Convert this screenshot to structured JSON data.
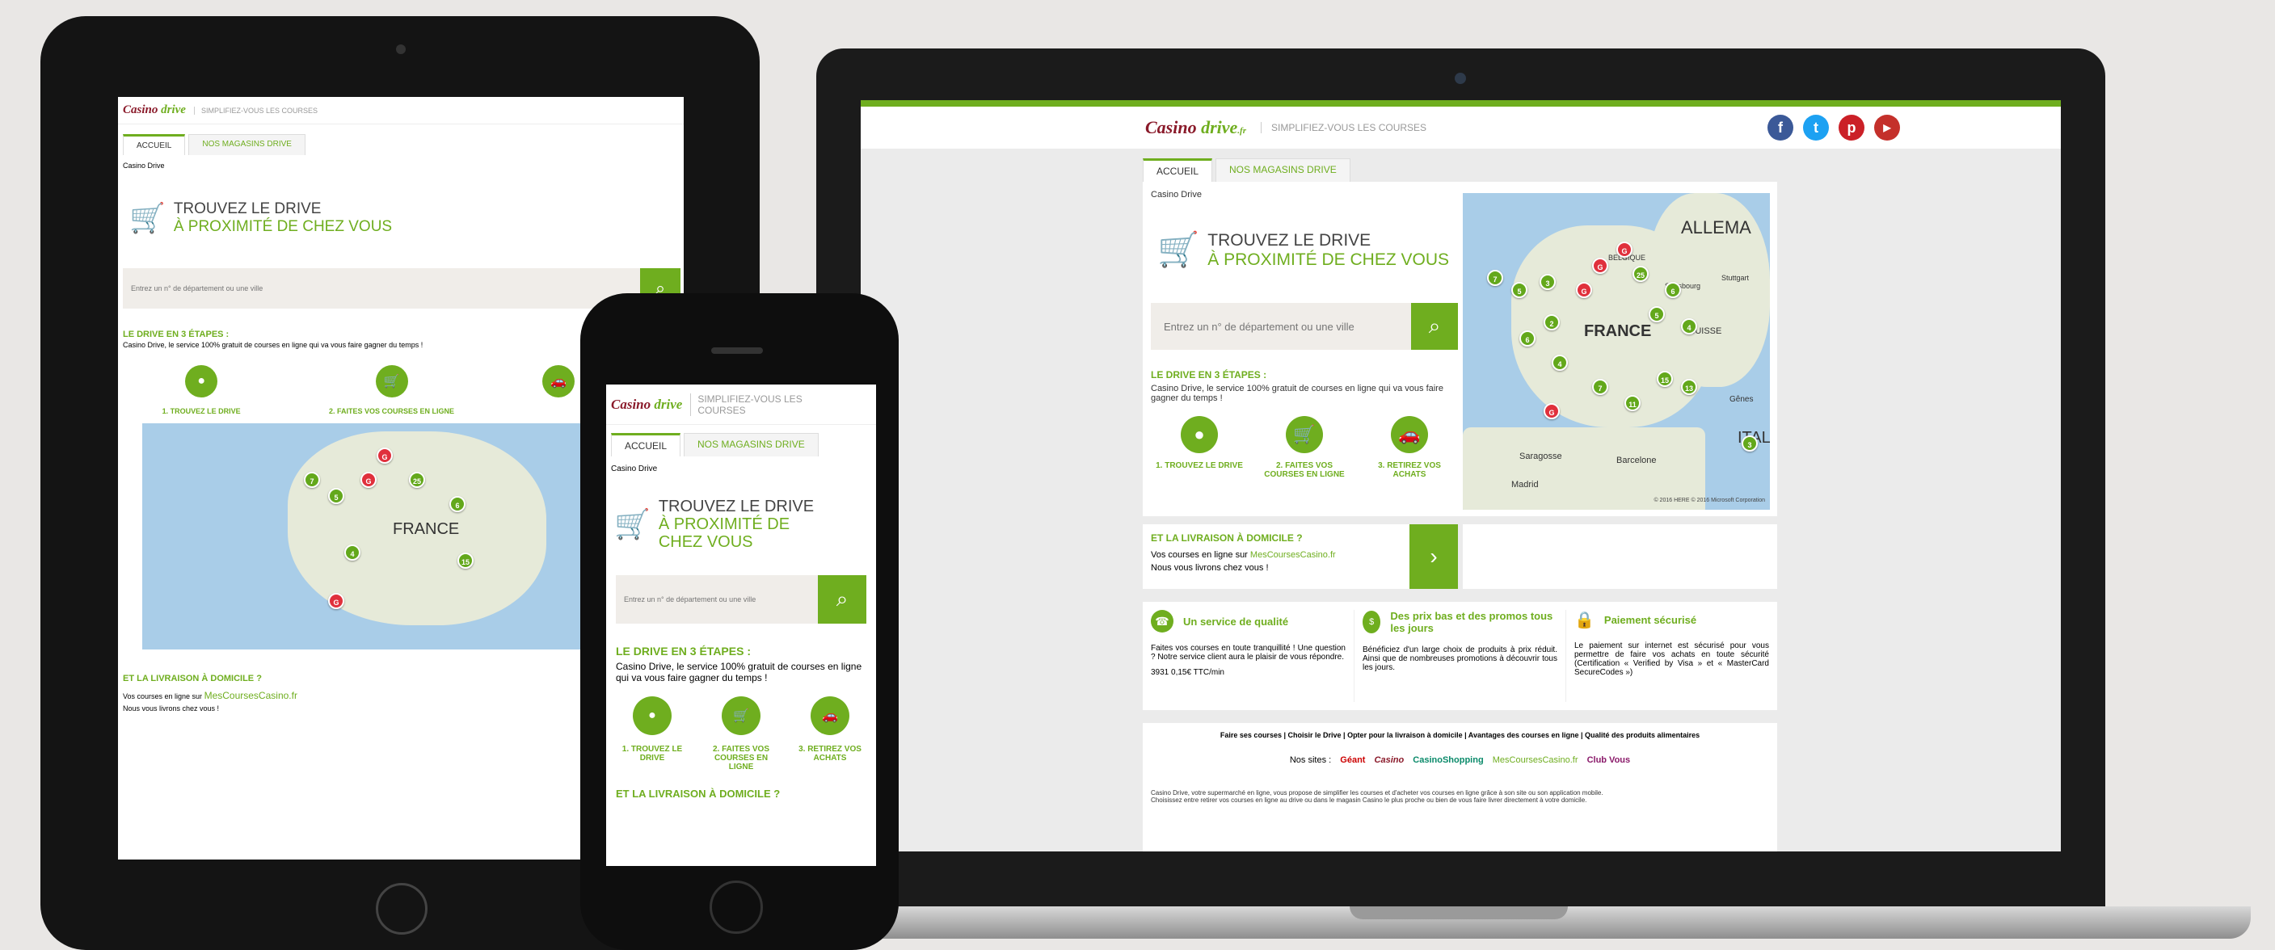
{
  "brand": {
    "logo_text": "Casino",
    "logo_drive": "drive",
    "logo_suffix": ".fr",
    "tagline": "SIMPLIFIEZ-VOUS LES COURSES"
  },
  "tabs": [
    "ACCUEIL",
    "NOS MAGASINS DRIVE"
  ],
  "breadcrumb": "Casino Drive",
  "hero": {
    "line1": "TROUVEZ LE DRIVE",
    "line2": "À PROXIMITÉ DE CHEZ VOUS"
  },
  "search": {
    "placeholder": "Entrez un n° de département ou une ville"
  },
  "steps": {
    "title": "LE DRIVE EN 3 ÉTAPES :",
    "desc": "Casino Drive, le service 100% gratuit de courses en ligne qui va vous faire gagner du temps !",
    "items": [
      "1. TROUVEZ LE DRIVE",
      "2. FAITES VOS COURSES EN LIGNE",
      "3. RETIREZ VOS ACHATS"
    ]
  },
  "map_labels": {
    "country": "FRANCE",
    "germany": "ALLEMA",
    "belgium": "BELGIQUE",
    "swiss": "SUISSE",
    "madrid": "Madrid",
    "barcelona": "Barcelone",
    "genes": "Gênes",
    "saragosse": "Saragosse",
    "stuttgart": "Stuttgart",
    "strasbourg": "Strasbourg",
    "italy": "ITAL",
    "copyright": "© 2016 HERE  © 2016 Microsoft Corporation"
  },
  "delivery": {
    "title": "ET LA LIVRAISON À DOMICILE ?",
    "line1": "Vos courses en ligne sur",
    "brand": "MesCoursesCasino.fr",
    "line2": "Nous vous livrons chez vous !"
  },
  "features": [
    {
      "title": "Un service de qualité",
      "text": "Faites vos courses en toute tranquillité ! Une question ? Notre service client aura le plaisir de vous répondre.",
      "extra": "3931 0,15€ TTC/min"
    },
    {
      "title": "Des prix bas et des promos tous les jours",
      "text": "Bénéficiez d'un large choix de produits à prix réduit. Ainsi que de nombreuses promotions à découvrir tous les jours."
    },
    {
      "title": "Paiement sécurisé",
      "text": "Le paiement sur internet est sécurisé pour vous permettre de faire vos achats en toute sécurité (Certification « Verified by Visa » et « MasterCard SecureCodes »)"
    }
  ],
  "footer": {
    "links": [
      "Faire ses courses",
      "Choisir le Drive",
      "Opter pour la livraison à domicile",
      "Avantages des courses en ligne",
      "Qualité des produits alimentaires"
    ],
    "sites_label": "Nos sites :",
    "sites": [
      "Géant",
      "Casino",
      "CasinoShopping",
      "MesCoursesCasino.fr",
      "Club Vous"
    ],
    "about1": "Casino Drive, votre supermarché en ligne, vous propose de simplifier les courses et d'acheter vos courses en ligne grâce à son site ou son application mobile.",
    "about2": "Choisissez entre retirer vos courses en ligne au drive ou dans le magasin Casino le plus proche ou bien de vous faire livrer directement à votre domicile."
  },
  "social": [
    {
      "icon": "facebook-icon",
      "glyph": "f",
      "color": "#3b5998"
    },
    {
      "icon": "twitter-icon",
      "glyph": "t",
      "color": "#1da1f2"
    },
    {
      "icon": "pinterest-icon",
      "glyph": "p",
      "color": "#cb2027"
    },
    {
      "icon": "youtube-icon",
      "glyph": "▶",
      "color": "#c4302b"
    }
  ],
  "colors": {
    "accent": "#6fae1f",
    "brand_red": "#8a1a2a"
  }
}
